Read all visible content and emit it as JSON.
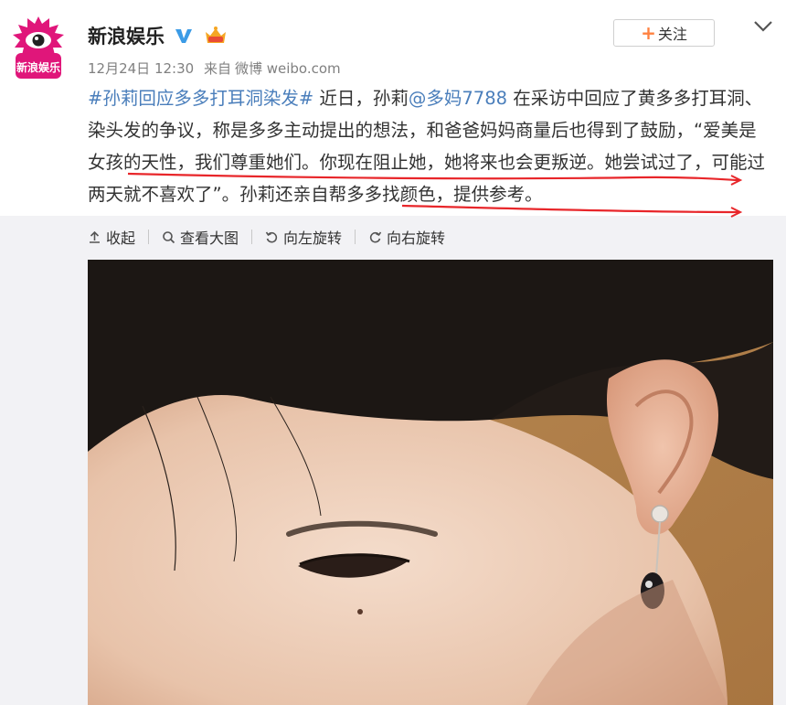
{
  "post": {
    "author": "新浪娱乐",
    "avatar_text": "新浪娱乐",
    "timestamp": "12月24日 12:30",
    "source_prefix": "来自",
    "source": "微博 weibo.com",
    "follow_label": "关注",
    "body": {
      "hashtag": "#孙莉回应多多打耳洞染发#",
      "text_1": " 近日，孙莉",
      "mention": "@多妈7788",
      "text_2": " 在采访中回应了黄多多打耳洞、染头发的争议，称是多多主动提出的想法，和爸爸妈妈商量后也得到了鼓励，“爱美是女孩的天性，我们尊重她们。你现在阻止她，她将来也会更叛逆。她尝试过了，可能过两天就不喜欢了”。孙莉还亲自帮多多找颜色，提供参考。"
    }
  },
  "toolbar": {
    "collapse": "收起",
    "view_large": "查看大图",
    "rotate_left": "向左旋转",
    "rotate_right": "向右旋转"
  },
  "colors": {
    "link": "#4a7ebb",
    "annotation_red": "#e8262a",
    "follow_plus": "#ff8140",
    "toolbar_bg": "#f2f2f5"
  },
  "icons": [
    "sina-entertainment-logo",
    "verified-v-icon",
    "vip-crown-icon",
    "chevron-down-icon",
    "upload-arrow-icon",
    "search-icon",
    "rotate-left-icon",
    "rotate-right-icon"
  ]
}
